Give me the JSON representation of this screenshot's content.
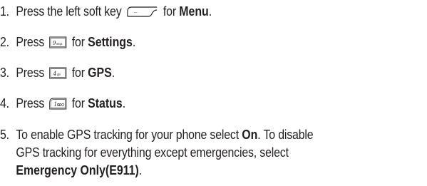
{
  "steps": [
    {
      "number": "1.",
      "before": "Press the left soft key",
      "key_icon": "left-soft-key-icon",
      "after": "for",
      "bold": "Menu",
      "end": "."
    },
    {
      "number": "2.",
      "before": "Press",
      "key_icon": "key-9-wxyz-icon",
      "key_label": "9wxyz",
      "after": "for",
      "bold": "Settings",
      "end": "."
    },
    {
      "number": "3.",
      "before": "Press",
      "key_icon": "key-4-ghi-icon",
      "key_label": "4ghi",
      "after": "for",
      "bold": "GPS",
      "end": "."
    },
    {
      "number": "4.",
      "before": "Press",
      "key_icon": "key-1-voicemail-icon",
      "key_label": "1",
      "after": "for",
      "bold": "Status",
      "end": "."
    },
    {
      "number": "5.",
      "line1_text": "To enable GPS tracking for your phone select",
      "line1_bold": "On",
      "line1_end": ". To disable",
      "line2_text": "GPS tracking for everything except emergencies, select",
      "line3_bold": "Emergency Only(E911)",
      "line3_end": "."
    }
  ]
}
